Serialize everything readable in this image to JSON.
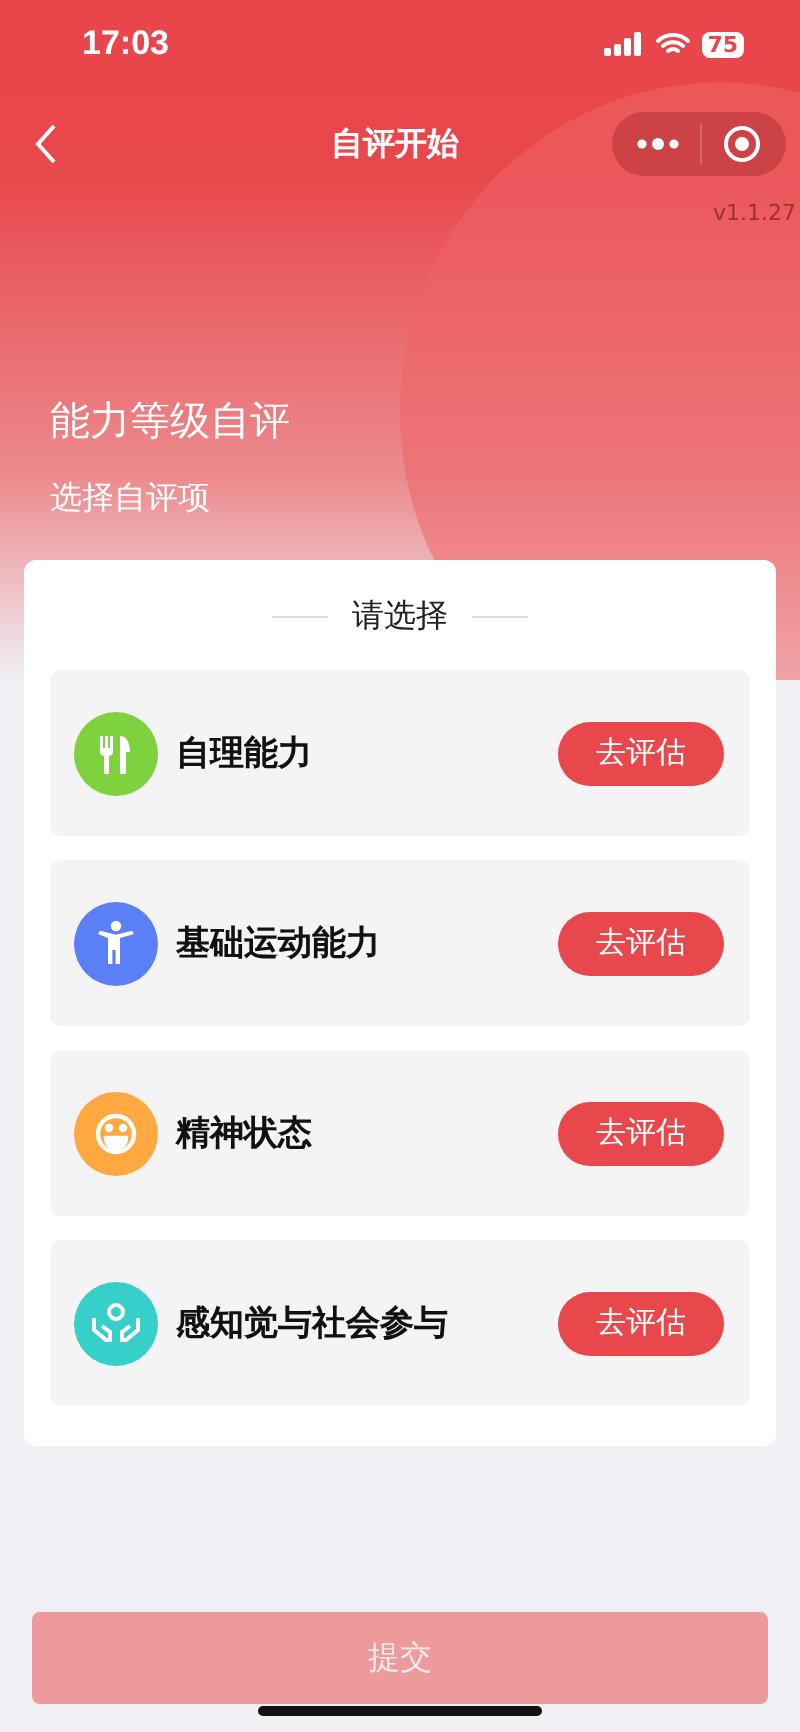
{
  "status_bar": {
    "time": "17:03",
    "battery": "75"
  },
  "nav": {
    "title": "自评开始",
    "version": "v1.1.27"
  },
  "hero": {
    "title": "能力等级自评",
    "subtitle": "选择自评项"
  },
  "card": {
    "heading": "请选择",
    "items": [
      {
        "name": "自理能力",
        "color": "#7ed23e",
        "action": "去评估"
      },
      {
        "name": "基础运动能力",
        "color": "#5b7ff5",
        "action": "去评估"
      },
      {
        "name": "精神状态",
        "color": "#ffa940",
        "action": "去评估"
      },
      {
        "name": "感知觉与社会参与",
        "color": "#36cfc9",
        "action": "去评估"
      }
    ]
  },
  "submit": {
    "label": "提交",
    "disabled": true
  }
}
